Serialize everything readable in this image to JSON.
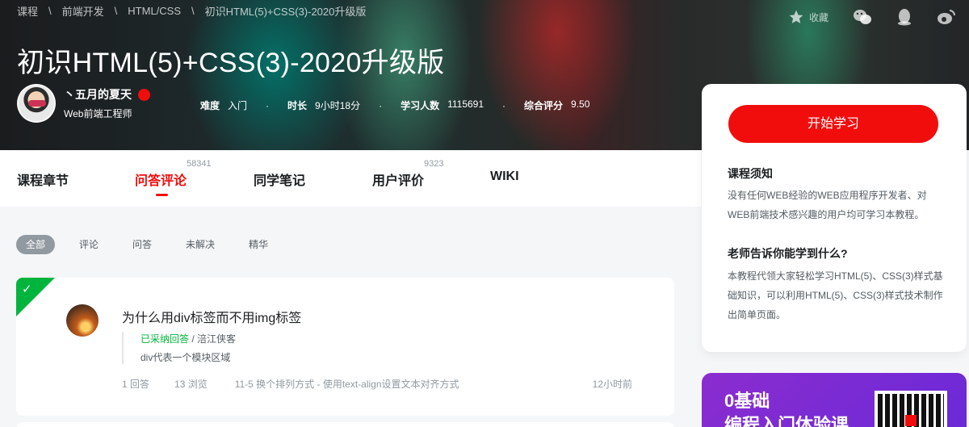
{
  "breadcrumbs": [
    "课程",
    "前端开发",
    "HTML/CSS",
    "初识HTML(5)+CSS(3)-2020升级版"
  ],
  "breadcrumb_separator": "\\",
  "hero_actions": {
    "favorite_label": "收藏"
  },
  "course_title": "初识HTML(5)+CSS(3)-2020升级版",
  "author": {
    "name": "丶五月的夏天",
    "role": "Web前端工程师"
  },
  "stats": [
    {
      "label": "难度",
      "value": "入门"
    },
    {
      "label": "时长",
      "value": "9小时18分"
    },
    {
      "label": "学习人数",
      "value": "1115691"
    },
    {
      "label": "综合评分",
      "value": "9.50"
    }
  ],
  "stat_separator": "·",
  "tabs": [
    {
      "label": "课程章节",
      "count": ""
    },
    {
      "label": "问答评论",
      "count": "58341"
    },
    {
      "label": "同学笔记",
      "count": ""
    },
    {
      "label": "用户评价",
      "count": "9323"
    },
    {
      "label": "WIKI",
      "count": ""
    }
  ],
  "filters": [
    "全部",
    "评论",
    "问答",
    "未解决",
    "精华"
  ],
  "question": {
    "title": "为什么用div标签而不用img标签",
    "accepted_label": "已采纳回答",
    "answer_separator": " / ",
    "answer_author": "涪江侠客",
    "answer_text": "div代表一个模块区域",
    "replies": "1 回答",
    "views": "13 浏览",
    "chapter": "11-5 换个排列方式 - 使用text-align设置文本对齐方式",
    "time": "12小时前"
  },
  "sidebar": {
    "start_button": "开始学习",
    "notice_title": "课程须知",
    "notice_text": "没有任何WEB经验的WEB应用程序开发者、对WEB前端技术感兴趣的用户均可学习本教程。",
    "learn_title": "老师告诉你能学到什么?",
    "learn_text": "本教程代领大家轻松学习HTML(5)、CSS(3)样式基础知识，可以利用HTML(5)、CSS(3)样式技术制作出简单页面。"
  },
  "promo": {
    "line1": "0基础",
    "line2": "编程入门体验课"
  },
  "colors": {
    "accent": "#f20d0d",
    "accepted": "#00b43c",
    "promo": "#8b2ccf"
  }
}
